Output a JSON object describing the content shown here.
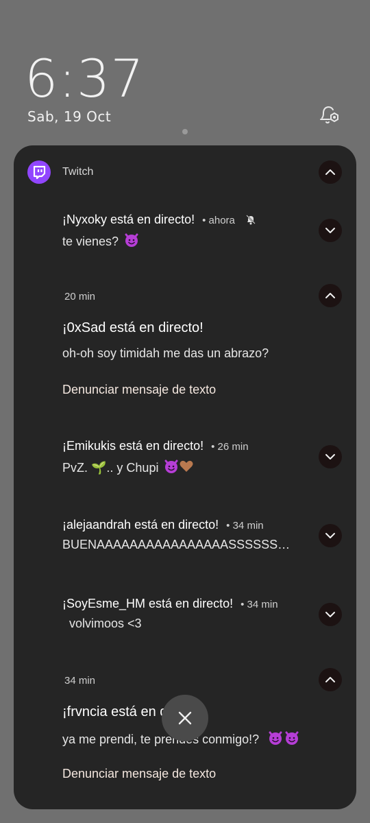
{
  "lockscreen": {
    "time": "6:37",
    "date": "Sab, 19 Oct"
  },
  "group": {
    "app_name": "Twitch",
    "accent": "#9146ff"
  },
  "notifications": [
    {
      "title": "¡Nyxoky está en directo!",
      "meta": "• ahora",
      "body": "te vienes?",
      "emoji": [
        "devil"
      ],
      "muted_icon": "bell-off-icon",
      "expanded": false
    },
    {
      "time": "20 min",
      "title": "¡0xSad está en directo!",
      "body": "oh-oh soy timidah me das un abrazo?",
      "action": "Denunciar mensaje de texto",
      "expanded": true
    },
    {
      "title": "¡Emikukis está en directo!",
      "meta": "• 26 min",
      "body": "PvZ. 🌱.. y Chupi",
      "emoji": [
        "devil",
        "heart"
      ],
      "expanded": false
    },
    {
      "title": "¡alejaandrah está en directo!",
      "meta": "• 34 min",
      "body": "BUENAAAAAAAAAAAAAAAASSSSSS…",
      "expanded": false
    },
    {
      "title": "¡SoyEsme_HM está en directo!",
      "meta": "• 34 min",
      "body": "  volvimoos <3",
      "expanded": false
    },
    {
      "time": "34 min",
      "title": "¡frvncia está en directo!",
      "body": "ya me prendi, te prendes conmigo!?",
      "emoji": [
        "devil",
        "devil"
      ],
      "action": "Denunciar mensaje de texto",
      "expanded": true
    }
  ],
  "colors": {
    "panel": "#252525",
    "background": "#707070"
  }
}
